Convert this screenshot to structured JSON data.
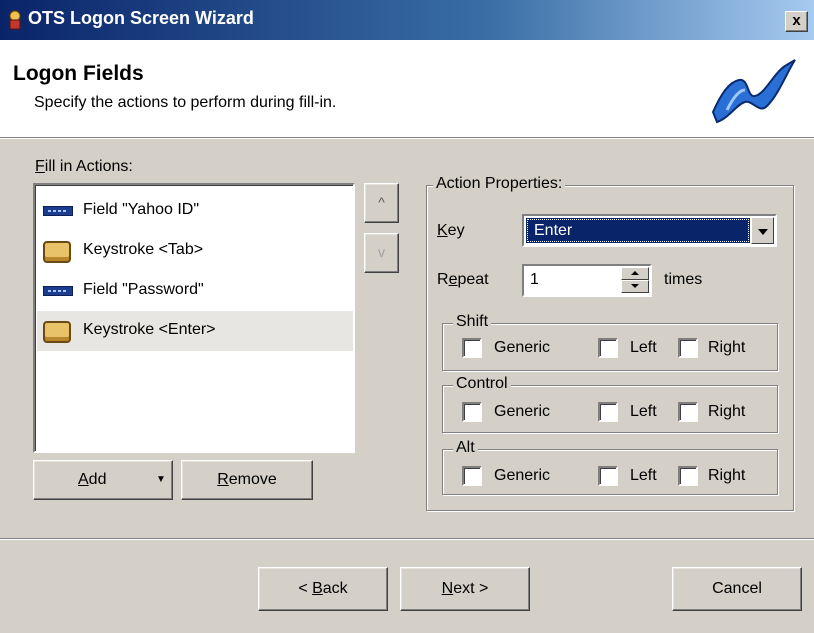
{
  "window": {
    "title": "OTS Logon Screen Wizard",
    "close_label": "x"
  },
  "header": {
    "title": "Logon Fields",
    "subtitle": "Specify the actions to perform during fill-in."
  },
  "actions": {
    "label": "Fill in Actions:",
    "items": [
      {
        "icon": "field-icon",
        "label": "Field \"Yahoo ID\"",
        "selected": false
      },
      {
        "icon": "keystroke-icon",
        "label": "Keystroke <Tab>",
        "selected": false
      },
      {
        "icon": "field-icon",
        "label": "Field \"Password\"",
        "selected": false
      },
      {
        "icon": "keystroke-icon",
        "label": "Keystroke <Enter>",
        "selected": true
      }
    ],
    "move_up_label": "^",
    "move_down_label": "v",
    "add_label": "Add",
    "remove_label": "Remove"
  },
  "properties": {
    "legend": "Action Properties:",
    "key_label": "Key",
    "key_value": "Enter",
    "repeat_label": "Repeat",
    "repeat_value": "1",
    "times_label": "times",
    "groups": [
      {
        "legend": "Shift",
        "generic": "Generic",
        "left": "Left",
        "right": "Right"
      },
      {
        "legend": "Control",
        "generic": "Generic",
        "left": "Left",
        "right": "Right"
      },
      {
        "legend": "Alt",
        "generic": "Generic",
        "left": "Left",
        "right": "Right"
      }
    ]
  },
  "footer": {
    "back_label": "< Back",
    "next_label": "Next >",
    "cancel_label": "Cancel"
  },
  "colors": {
    "titlebar": "#0a246a",
    "selection": "#0a246a",
    "face": "#d4d0c8"
  }
}
